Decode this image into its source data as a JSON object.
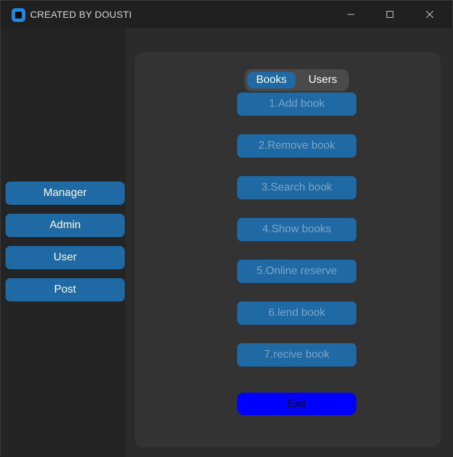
{
  "window": {
    "title": "CREATED BY DOUSTI",
    "icon": "app-icon",
    "controls": [
      "minimize-icon",
      "maximize-icon",
      "close-icon"
    ]
  },
  "sidebar": {
    "buttons": [
      {
        "label": "Manager"
      },
      {
        "label": "Admin"
      },
      {
        "label": "User"
      },
      {
        "label": "Post"
      }
    ]
  },
  "tabs": {
    "items": [
      {
        "label": "Books",
        "selected": true
      },
      {
        "label": "Users",
        "selected": false
      }
    ]
  },
  "books_menu": {
    "items": [
      {
        "label": "1.Add book"
      },
      {
        "label": "2.Remove book"
      },
      {
        "label": "3.Search book"
      },
      {
        "label": "4.Show books"
      },
      {
        "label": "5.Online reserve"
      },
      {
        "label": "6.lend book"
      },
      {
        "label": "7.recive book"
      }
    ],
    "exit_label": "Exit"
  },
  "colors": {
    "accent": "#1f6aa5",
    "exit": "#0000ff",
    "panel": "#333333",
    "background": "#2b2b2b"
  }
}
